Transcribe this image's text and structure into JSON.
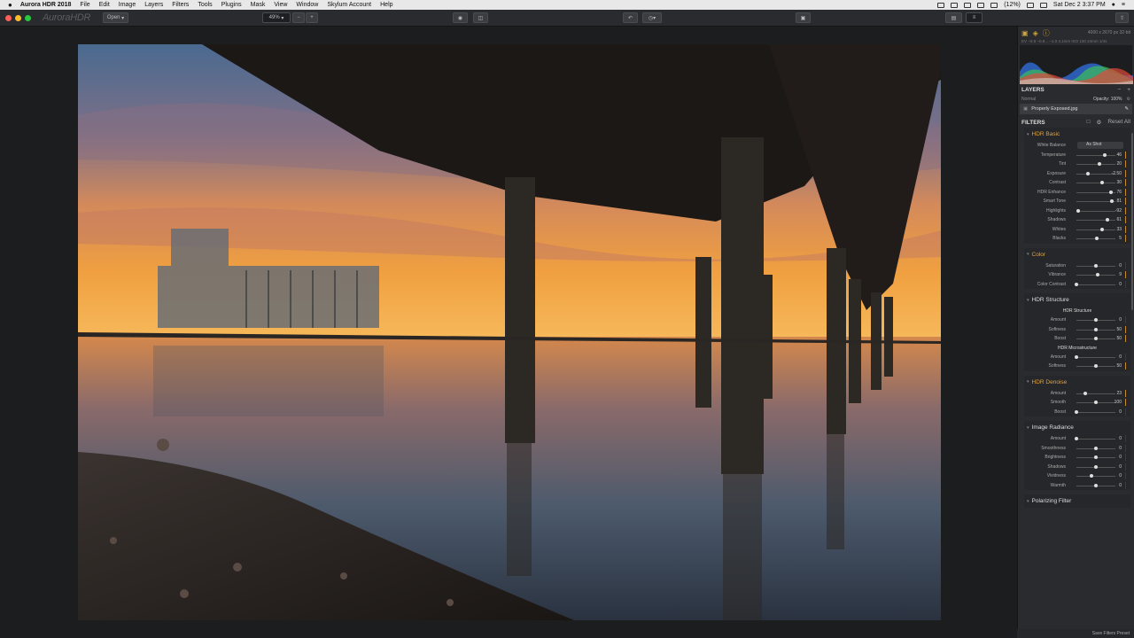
{
  "menubar": {
    "app": "Aurora HDR 2018",
    "items": [
      "File",
      "Edit",
      "Image",
      "Layers",
      "Filters",
      "Tools",
      "Plugins",
      "Mask",
      "View",
      "Window",
      "Skylum Account",
      "Help"
    ],
    "battery": "(12%)",
    "clock": "Sat Dec 2  3:37 PM"
  },
  "toolbar": {
    "logo": "AuroraHDR",
    "open": "Open",
    "zoom": "49%",
    "zoom_out": "−",
    "zoom_in": "+"
  },
  "panel": {
    "image_info": "4000 x 2670 px   32-bit",
    "exif": "EV −0.9 −0.9...  −1.0  4.1mm  ISO 100  24mm  1/4s",
    "layers": {
      "title": "LAYERS",
      "blend": "Normal",
      "opacity": "Opacity: 100%",
      "layer_name": "Properly Exposed.jpg"
    },
    "filters": {
      "title": "FILTERS",
      "reset": "Reset All",
      "save": "Save Filters Preset"
    },
    "hdr_basic": {
      "title": "HDR Basic",
      "wb_label": "White Balance",
      "wb_value": "As Shot",
      "rows": [
        {
          "label": "Temperature",
          "value": "46",
          "pos": 0.73
        },
        {
          "label": "Tint",
          "value": "20",
          "pos": 0.6
        },
        {
          "label": "Exposure",
          "value": "-2.50",
          "pos": 0.29
        },
        {
          "label": "Contrast",
          "value": "30",
          "pos": 0.65
        },
        {
          "label": "HDR Enhance",
          "value": "76",
          "pos": 0.88
        },
        {
          "label": "Smart Tone",
          "value": "81",
          "pos": 0.9
        },
        {
          "label": "Highlights",
          "value": "-92",
          "pos": 0.04
        },
        {
          "label": "Shadows",
          "value": "61",
          "pos": 0.8
        },
        {
          "label": "Whites",
          "value": "33",
          "pos": 0.67
        },
        {
          "label": "Blacks",
          "value": "5",
          "pos": 0.52
        }
      ]
    },
    "color": {
      "title": "Color",
      "rows": [
        {
          "label": "Saturation",
          "value": "0",
          "pos": 0.5
        },
        {
          "label": "Vibrance",
          "value": "9",
          "pos": 0.55
        },
        {
          "label": "Color Contrast",
          "value": "0",
          "pos": 0.0
        }
      ]
    },
    "hdr_structure": {
      "title": "HDR Structure",
      "group1": "HDR Structure",
      "rows1": [
        {
          "label": "Amount",
          "value": "0",
          "pos": 0.5
        },
        {
          "label": "Softness",
          "value": "50",
          "pos": 0.5
        },
        {
          "label": "Boost",
          "value": "50",
          "pos": 0.5
        }
      ],
      "group2": "HDR Microstructure",
      "rows2": [
        {
          "label": "Amount",
          "value": "0",
          "pos": 0.0
        },
        {
          "label": "Softness",
          "value": "50",
          "pos": 0.5
        }
      ]
    },
    "hdr_denoise": {
      "title": "HDR Denoise",
      "rows": [
        {
          "label": "Amount",
          "value": "23",
          "pos": 0.23
        },
        {
          "label": "Smooth",
          "value": "100",
          "pos": 0.5
        },
        {
          "label": "Boost",
          "value": "0",
          "pos": 0.0
        }
      ]
    },
    "image_radiance": {
      "title": "Image Radiance",
      "rows": [
        {
          "label": "Amount",
          "value": "0",
          "pos": 0.0
        },
        {
          "label": "Smoothness",
          "value": "0",
          "pos": 0.5
        },
        {
          "label": "Brightness",
          "value": "0",
          "pos": 0.5
        },
        {
          "label": "Shadows",
          "value": "0",
          "pos": 0.5
        },
        {
          "label": "Vividness",
          "value": "0",
          "pos": 0.38
        },
        {
          "label": "Warmth",
          "value": "0",
          "pos": 0.5
        }
      ]
    },
    "polarizing": {
      "title": "Polarizing Filter"
    }
  }
}
